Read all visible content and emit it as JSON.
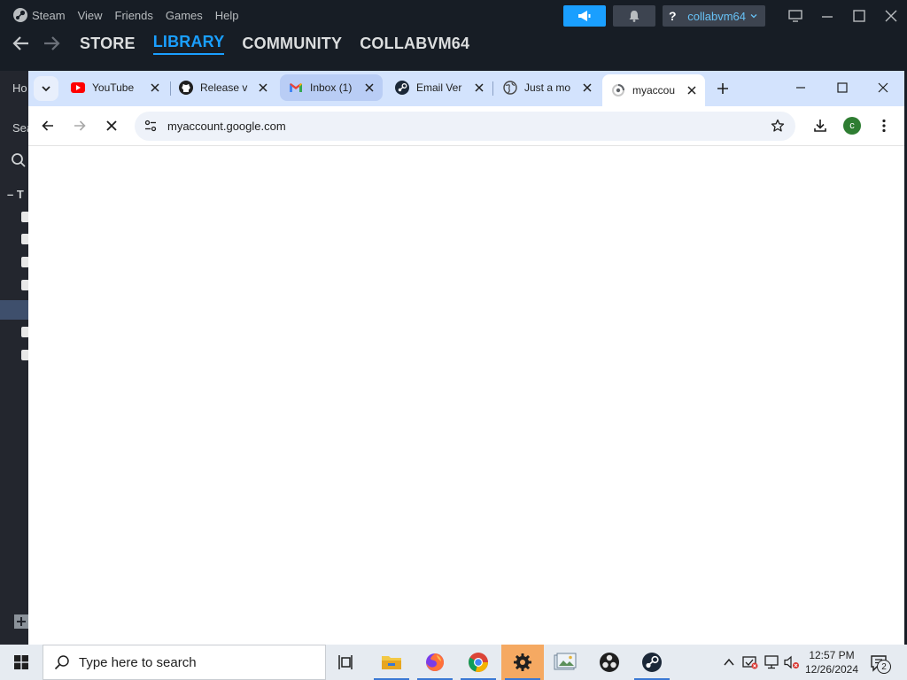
{
  "steam": {
    "menu": [
      "Steam",
      "View",
      "Friends",
      "Games",
      "Help"
    ],
    "help_label": "?",
    "username": "collabvm64",
    "nav_tabs": [
      "STORE",
      "LIBRARY",
      "COMMUNITY",
      "COLLABVM64"
    ],
    "sidebar_home": "Ho",
    "sidebar_search": "Sea",
    "sidebar_section": "T",
    "colors": {
      "accent": "#1a9fff",
      "bg": "#171d25"
    }
  },
  "chrome": {
    "tabs": [
      {
        "title": "YouTube",
        "icon": "youtube-icon"
      },
      {
        "title": "Release v",
        "icon": "github-icon"
      },
      {
        "title": "Inbox (1)",
        "icon": "gmail-icon"
      },
      {
        "title": "Email Ver",
        "icon": "steam-icon"
      },
      {
        "title": "Just a mo",
        "icon": "globe-icon"
      },
      {
        "title": "myaccou",
        "icon": "loading-icon"
      }
    ],
    "url": "myaccount.google.com",
    "avatar_letter": "c",
    "colors": {
      "tabstrip": "#d3e3fd",
      "omnibox": "#eef2f9"
    }
  },
  "taskbar": {
    "search_placeholder": "Type here to search",
    "time": "12:57 PM",
    "date": "12/26/2024",
    "notifications": "2"
  }
}
